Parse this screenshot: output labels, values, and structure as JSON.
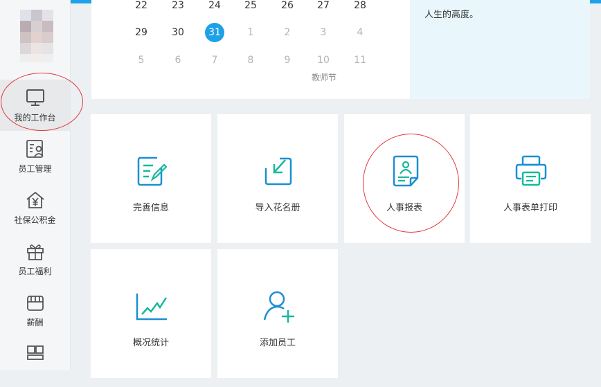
{
  "colors": {
    "accent": "#1da1e8",
    "icon_teal": "#16b99a",
    "icon_blue": "#1b8fd4",
    "annotation": "#e0393e"
  },
  "sidebar": {
    "items": [
      {
        "label": "我的工作台",
        "icon": "monitor-icon",
        "active": true
      },
      {
        "label": "员工管理",
        "icon": "employee-card-icon"
      },
      {
        "label": "社保公积金",
        "icon": "house-yen-icon"
      },
      {
        "label": "员工福利",
        "icon": "gift-icon"
      },
      {
        "label": "薪酬",
        "icon": "wallet-icon"
      },
      {
        "label": "",
        "icon": "layout-icon"
      }
    ]
  },
  "calendar": {
    "rows": [
      [
        "22",
        "23",
        "24",
        "25",
        "26",
        "27",
        "28"
      ],
      [
        "29",
        "30",
        "31",
        "1",
        "2",
        "3",
        "4"
      ],
      [
        "5",
        "6",
        "7",
        "8",
        "9",
        "10",
        "11"
      ]
    ],
    "today": "31",
    "event_label": "教师节"
  },
  "quote": {
    "text": "人生的高度。"
  },
  "cards": [
    {
      "label": "完善信息",
      "icon": "edit-document-icon"
    },
    {
      "label": "导入花名册",
      "icon": "import-arrow-icon"
    },
    {
      "label": "人事报表",
      "icon": "personnel-report-icon"
    },
    {
      "label": "人事表单打印",
      "icon": "printer-icon"
    },
    {
      "label": "概况统计",
      "icon": "line-chart-icon"
    },
    {
      "label": "添加员工",
      "icon": "add-user-icon"
    }
  ]
}
